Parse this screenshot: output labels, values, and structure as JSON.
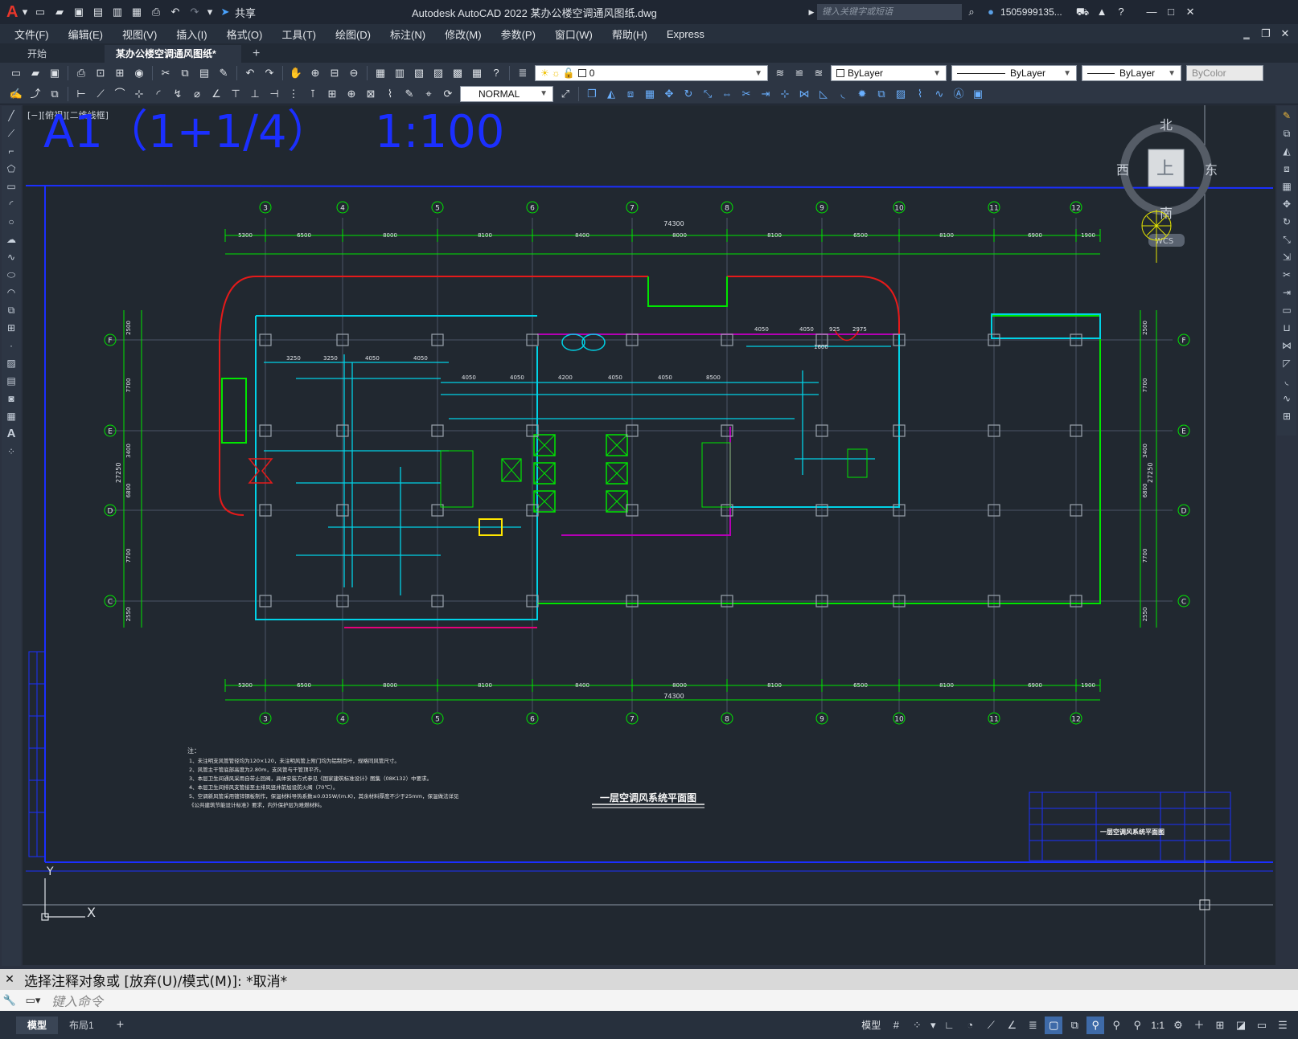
{
  "titlebar": {
    "logo": "A",
    "share_label": "共享",
    "title": "Autodesk AutoCAD 2022    某办公楼空调通风图纸.dwg",
    "search_placeholder": "键入关键字或短语",
    "user": "1505999135..."
  },
  "menu": [
    "文件(F)",
    "编辑(E)",
    "视图(V)",
    "插入(I)",
    "格式(O)",
    "工具(T)",
    "绘图(D)",
    "标注(N)",
    "修改(M)",
    "参数(P)",
    "窗口(W)",
    "帮助(H)",
    "Express"
  ],
  "tabs": {
    "start": "开始",
    "doc": "某办公楼空调通风图纸*",
    "close": "×",
    "add": "+"
  },
  "toolbar": {
    "layer": "0",
    "color": "ByLayer",
    "linetype": "ByLayer",
    "lineweight": "ByLayer",
    "plotstyle": "ByColor",
    "dimstyle": "NORMAL"
  },
  "viewport": {
    "label": "[−][俯视][二维线框]",
    "heading_scale": "A1（1+1/4）",
    "heading_ratio": "1:100"
  },
  "viewcube": {
    "north": "北",
    "south": "南",
    "east": "东",
    "west": "西",
    "top": "上",
    "wcs": "WCS"
  },
  "drawing": {
    "columns": [
      "3",
      "4",
      "5",
      "6",
      "7",
      "8",
      "9",
      "10",
      "11",
      "12"
    ],
    "rows": [
      "F",
      "E",
      "D",
      "C"
    ],
    "top_dims": [
      "5300",
      "6500",
      "8000",
      "8100",
      "8400",
      "8000",
      "8100",
      "6500",
      "8100",
      "6900",
      "1900"
    ],
    "total_dim": "74300",
    "left_dims": [
      "2500",
      "7700",
      "3400",
      "6800",
      "7700",
      "2550"
    ],
    "left_total": "27250",
    "inner_dims": [
      "4050",
      "4050",
      "925",
      "2975",
      "1600",
      "3250",
      "3250",
      "4050",
      "4050",
      "4050",
      "4050",
      "4200",
      "4050",
      "4050",
      "8500"
    ],
    "title": "一层空调风系统平面图",
    "notes_title": "注：",
    "notes": [
      "1、未注明支风管管径均为120×120，未注明风管上附门均为铝制百叶，规格同风管尺寸。",
      "2、风管主干管底部高度为2.80m，支风管与干管顶平齐。",
      "3、本层卫生间通风采用自带止回阀，具体安装方式参见《国家建筑标准设计》图集（08K132）中要求。",
      "4、本层卫生间排风支管接至主排风竖井前加设防火阀（70℃）。",
      "5、空调新风管采用镀锌钢板制作，保温材料导热系数≤0.035W/(m.K)，其余材料厚度不少于25mm，保温做法详见",
      "   《公共建筑节能设计标准》要求，内外保护层为难燃材料。"
    ],
    "titleblock": "一层空调风系统平面图",
    "ucs_x": "X",
    "ucs_y": "Y"
  },
  "command": {
    "history": "选择注释对象或 [放弃(U)/模式(M)]: *取消*",
    "placeholder": "键入命令"
  },
  "status": {
    "layout_tabs": [
      "模型",
      "布局1"
    ],
    "add": "+",
    "model_label": "模型",
    "scale": "1:1"
  }
}
